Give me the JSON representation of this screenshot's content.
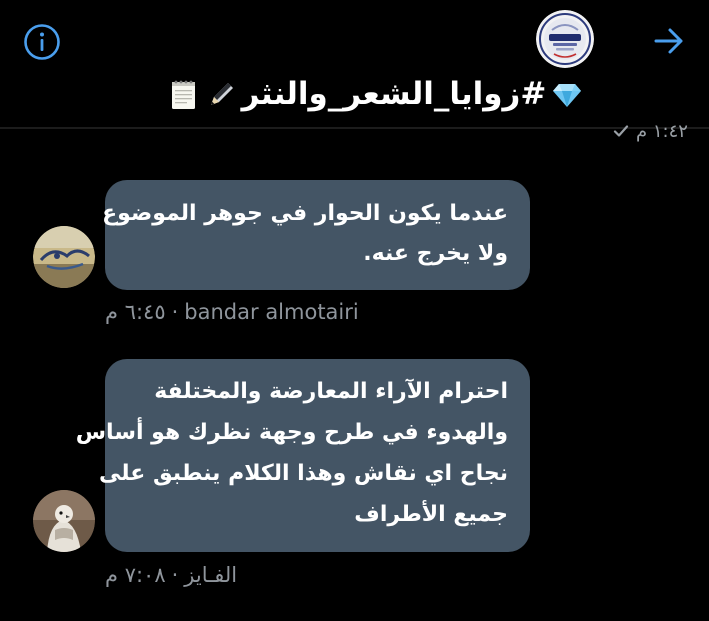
{
  "header": {
    "title": "#زوايا_الشعر_والنثر",
    "title_icons": [
      "gem-icon",
      "pen-icon",
      "notepad-icon"
    ],
    "logo_icon": "channel-logo-icon",
    "info_icon": "info-circle-icon",
    "forward_icon": "arrow-right-icon"
  },
  "previous_message": {
    "time": "١:٤٢ م",
    "status_icon": "check-icon"
  },
  "messages": [
    {
      "lines": [
        "عندما يكون الحوار في جوهر الموضوع",
        "ولا يخرج عنه."
      ],
      "author": "bandar almotairi",
      "separator": "·",
      "time": "٦:٤٥ م"
    },
    {
      "lines": [
        "احترام الآراء المعارضة والمختلفة",
        "والهدوء في طرح وجهة نظرك هو أساس",
        "نجاح اي نقاش وهذا الكلام ينطبق على",
        "جميع الأطراف"
      ],
      "author": "الفـايز",
      "separator": "·",
      "time": "٧:٠٨ م"
    }
  ],
  "colors": {
    "background": "#000000",
    "bubble": "#445565",
    "accent": "#4a9eed",
    "meta_text": "#8f959c"
  }
}
